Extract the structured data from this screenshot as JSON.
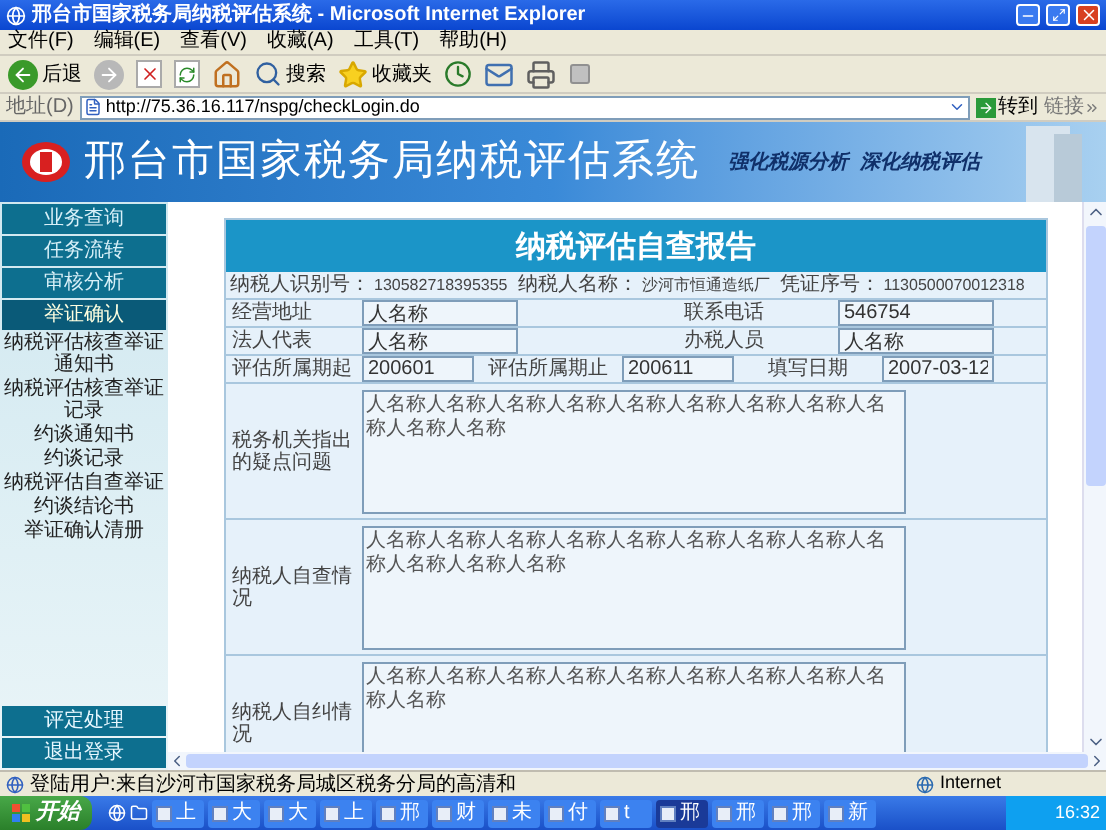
{
  "window": {
    "title": "邢台市国家税务局纳税评估系统 - Microsoft Internet Explorer"
  },
  "menu_bar": [
    "文件(F)",
    "编辑(E)",
    "查看(V)",
    "收藏(A)",
    "工具(T)",
    "帮助(H)"
  ],
  "toolbar": [
    {
      "kind": "back",
      "label": "后退"
    },
    {
      "kind": "forward"
    },
    {
      "kind": "stop"
    },
    {
      "kind": "refresh"
    },
    {
      "kind": "home"
    },
    {
      "kind": "search",
      "label": "搜索"
    },
    {
      "kind": "favorites",
      "label": "收藏夹"
    },
    {
      "kind": "history"
    },
    {
      "kind": "mail"
    },
    {
      "kind": "print"
    },
    {
      "kind": "edit"
    }
  ],
  "address_bar": {
    "label": "地址(D)",
    "url": "http://75.36.16.117/nspg/checkLogin.do",
    "go_button": "转到",
    "links": "链接"
  },
  "banner": {
    "title": "邢台市国家税务局纳税评估系统",
    "slogan_1": "强化税源分析",
    "slogan_2": "深化纳税评估"
  },
  "sidebar": {
    "items": [
      {
        "label": "业务查询",
        "expanded": false
      },
      {
        "label": "任务流转",
        "expanded": false
      },
      {
        "label": "审核分析",
        "expanded": false
      },
      {
        "label": "举证确认",
        "expanded": true,
        "children": [
          {
            "label": "纳税评估核查举证通知书"
          },
          {
            "label": "纳税评估核查举证记录"
          },
          {
            "label": "约谈通知书"
          },
          {
            "label": "约谈记录"
          },
          {
            "label": "纳税评估自查举证"
          },
          {
            "label": "约谈结论书"
          },
          {
            "label": "举证确认清册"
          }
        ]
      }
    ],
    "bottom_items": [
      "评定处理",
      "退出登录"
    ]
  },
  "report": {
    "title": "纳税评估自查报告",
    "info": [
      {
        "label": "纳税人识别号：",
        "value": "130582718395355"
      },
      {
        "label": "纳税人名称：",
        "value": "沙河市恒通造纸厂"
      },
      {
        "label": "凭证序号：",
        "value": "1130500070012318"
      }
    ],
    "rows": [
      {
        "fields": [
          {
            "label": "经营地址",
            "value": "人名称"
          },
          {
            "label": "联系电话",
            "value": "546754"
          }
        ]
      },
      {
        "fields": [
          {
            "label": "法人代表",
            "value": "人名称"
          },
          {
            "label": "办税人员",
            "value": "人名称"
          }
        ]
      },
      {
        "fields": [
          {
            "label": "评估所属期起",
            "value": "200601"
          },
          {
            "label": "评估所属期止",
            "value": "200611"
          },
          {
            "label": "填写日期",
            "value": "2007-03-12"
          }
        ]
      }
    ],
    "text_sections": [
      {
        "label": "税务机关指出的疑点问题",
        "value": "人名称人名称人名称人名称人名称人名称人名称人名称人名称人名称人名称"
      },
      {
        "label": "纳税人自查情况",
        "value": "人名称人名称人名称人名称人名称人名称人名称人名称人名称人名称人名称人名称"
      },
      {
        "label": "纳税人自纠情况",
        "value": "人名称人名称人名称人名称人名称人名称人名称人名称人名称人名称"
      }
    ]
  },
  "status_bar": {
    "text": "登陆用户:来自沙河市国家税务局城区税务分局的高清和",
    "zone": "Internet"
  },
  "taskbar": {
    "start": "开始",
    "items": [
      {
        "label": "上",
        "selected": false
      },
      {
        "label": "大",
        "selected": false
      },
      {
        "label": "大",
        "selected": false
      },
      {
        "label": "上",
        "selected": false
      },
      {
        "label": "邢",
        "selected": false
      },
      {
        "label": "财",
        "selected": false
      },
      {
        "label": "未",
        "selected": false
      },
      {
        "label": "付",
        "selected": false
      },
      {
        "label": "t",
        "selected": false
      },
      {
        "label": "邢",
        "selected": true
      },
      {
        "label": "邢",
        "selected": false
      },
      {
        "label": "邢",
        "selected": false
      },
      {
        "label": "新",
        "selected": false
      }
    ],
    "clock": "16:32"
  }
}
